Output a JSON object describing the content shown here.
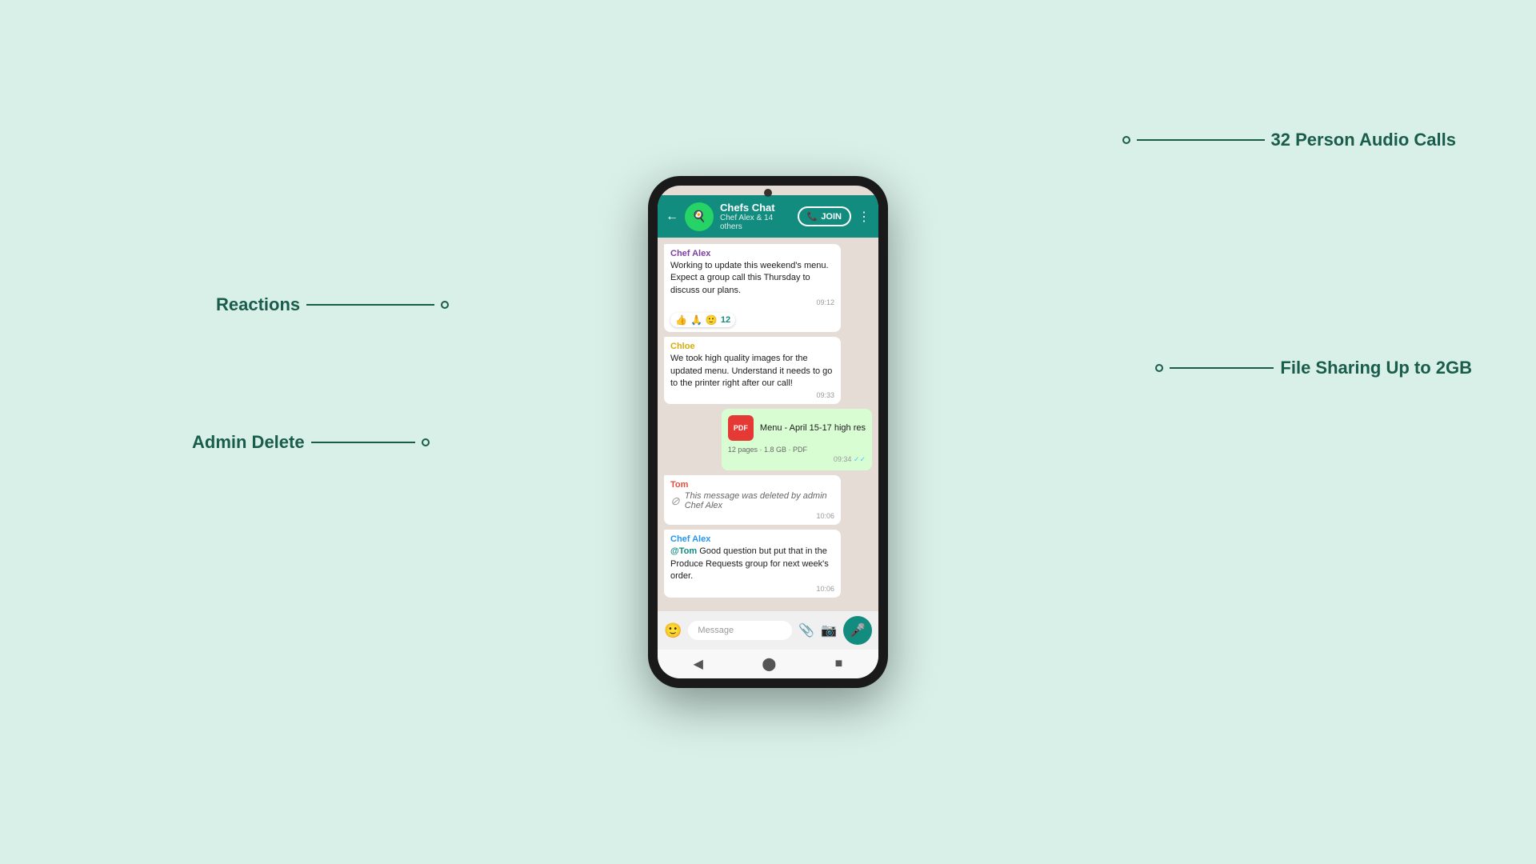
{
  "background_color": "#d8f0e8",
  "annotations": {
    "reactions": {
      "label": "Reactions"
    },
    "admin_delete": {
      "label": "Admin Delete"
    },
    "audio_calls": {
      "label": "32 Person Audio Calls"
    },
    "file_sharing": {
      "label": "File Sharing Up to 2GB"
    }
  },
  "phone": {
    "header": {
      "chat_name": "Chefs Chat",
      "chat_members": "Chef Alex & 14 others",
      "join_label": "JOIN",
      "back_icon": "←",
      "more_icon": "⋮"
    },
    "messages": [
      {
        "id": "msg1",
        "type": "received",
        "sender": "Chef Alex",
        "sender_color": "chef-alex",
        "text": "Working to update this weekend's menu. Expect a group call this Thursday to discuss our plans.",
        "time": "09:12",
        "reactions": [
          "👍",
          "🙏",
          "🙂",
          "12"
        ]
      },
      {
        "id": "msg2",
        "type": "received",
        "sender": "Chloe",
        "sender_color": "chloe",
        "text": "We took high quality images for the updated menu. Understand it needs to go to the printer right after our call!",
        "time": "09:33"
      },
      {
        "id": "msg3",
        "type": "sent",
        "file": true,
        "file_name": "Menu - April 15-17 high res",
        "file_meta": "12 pages · 1.8 GB · PDF",
        "time": "09:34",
        "ticks": "✓✓"
      },
      {
        "id": "msg4",
        "type": "received",
        "sender": "Tom",
        "sender_color": "tom",
        "deleted": true,
        "deleted_text": "This message was deleted by admin Chef Alex",
        "time": "10:06"
      },
      {
        "id": "msg5",
        "type": "received",
        "sender": "Chef Alex",
        "sender_color": "chef-alex2",
        "mention": "@Tom",
        "text": " Good question but put that in the Produce Requests group for next week's order.",
        "time": "10:06"
      }
    ],
    "input_placeholder": "Message",
    "nav": {
      "back": "◀",
      "home": "⬤",
      "recent": "■"
    }
  }
}
